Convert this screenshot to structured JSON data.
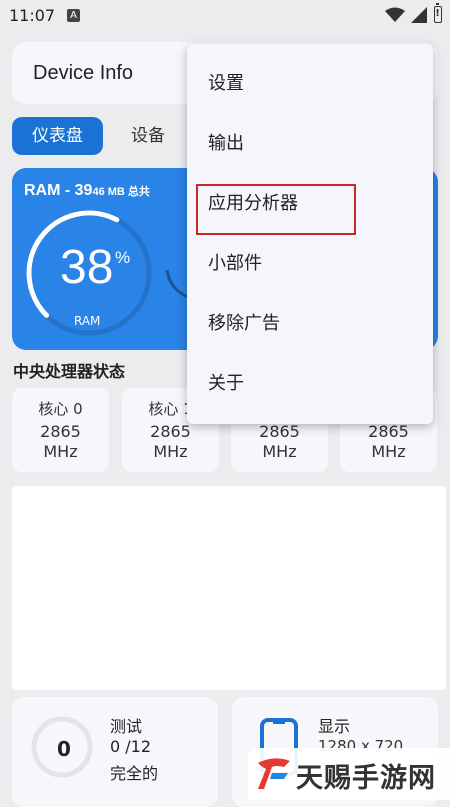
{
  "status_bar": {
    "time": "11:07",
    "notification_letter": "A"
  },
  "app_bar": {
    "title": "Device Info"
  },
  "tabs": [
    {
      "label": "仪表盘",
      "active": true
    },
    {
      "label": "设备",
      "active": false
    }
  ],
  "ram": {
    "title_prefix": "RAM - 39",
    "title_suffix": "46 MB 总共",
    "percent": "38",
    "percent_sign": "%",
    "label": "RAM",
    "usage_fraction": 0.38
  },
  "cpu": {
    "section_title": "中央处理器状态",
    "cores": [
      {
        "name": "核心 0",
        "freq": "2865",
        "unit": "MHz"
      },
      {
        "name": "核心 1",
        "freq": "2865",
        "unit": "MHz"
      },
      {
        "name": "",
        "freq": "2865",
        "unit": "MHz"
      },
      {
        "name": "",
        "freq": "2865",
        "unit": "MHz"
      }
    ]
  },
  "tests": {
    "title": "测试",
    "ring_value": "0",
    "count": "0 /12",
    "status": "完全的"
  },
  "display": {
    "title": "显示",
    "resolution": "1280 x 720"
  },
  "menu": {
    "items": [
      {
        "label": "设置"
      },
      {
        "label": "输出"
      },
      {
        "label": "应用分析器"
      },
      {
        "label": "小部件"
      },
      {
        "label": "移除广告"
      },
      {
        "label": "关于"
      }
    ]
  },
  "watermark": {
    "text": "天赐手游网"
  },
  "colors": {
    "accent": "#1a73d4",
    "ram_card": "#2a83e6",
    "highlight": "#c62828",
    "background": "#ececef"
  }
}
